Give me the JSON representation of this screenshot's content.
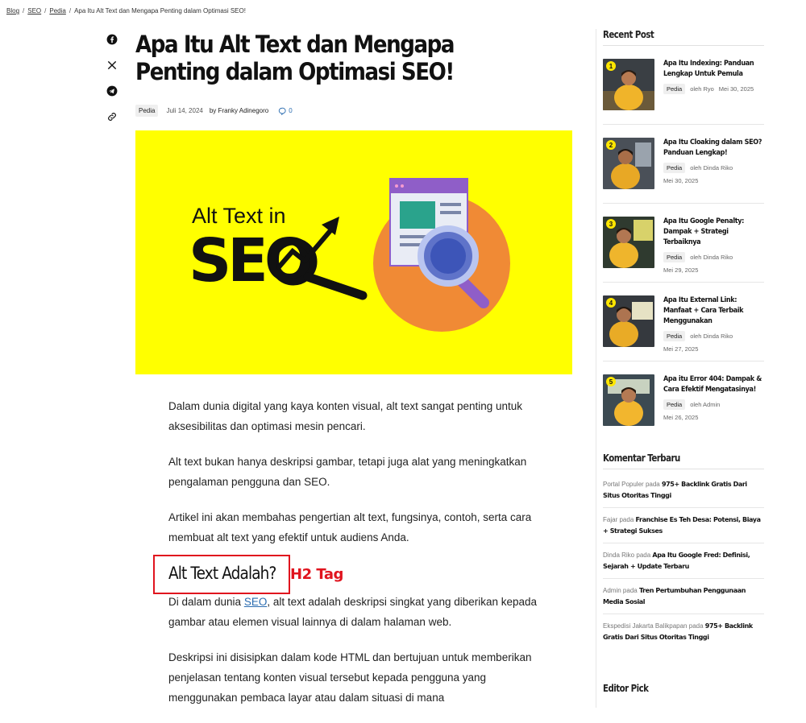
{
  "breadcrumb": {
    "items": [
      "Blog",
      "SEO",
      "Pedia"
    ],
    "current": "Apa Itu Alt Text dan Mengapa Penting dalam Optimasi SEO!"
  },
  "share": [
    "facebook-icon",
    "x-icon",
    "telegram-icon",
    "link-icon"
  ],
  "article": {
    "title": "Apa Itu Alt Text dan Mengapa Penting dalam Optimasi SEO!",
    "category": "Pedia",
    "date": "Juli 14, 2024",
    "author": "by Franky Adinegoro",
    "comment_count": "0",
    "hero": {
      "line1": "Alt Text in",
      "line2": "SEO",
      "bg_color": "#ffff00",
      "circle_color": "#f08a35"
    },
    "paragraphs": [
      "Dalam dunia digital yang kaya konten visual, alt text sangat penting untuk aksesibilitas dan optimasi mesin pencari.",
      "Alt text bukan hanya deskripsi gambar, tetapi juga alat yang meningkatkan pengalaman pengguna dan SEO.",
      "Artikel ini akan membahas pengertian alt text, fungsinya, contoh, serta cara membuat alt text yang efektif untuk audiens Anda."
    ],
    "h2": "Alt Text Adalah?",
    "h2_annotation": "H2 Tag",
    "p4_before": "Di dalam dunia ",
    "p4_link": "SEO",
    "p4_after": ", alt text adalah deskripsi singkat yang diberikan kepada gambar atau elemen visual lainnya di dalam halaman web.",
    "p5": "Deskripsi ini disisipkan dalam kode HTML dan bertujuan untuk memberikan penjelasan tentang konten visual tersebut kepada pengguna yang menggunakan pembaca layar atau dalam situasi di mana"
  },
  "sidebar": {
    "recent_title": "Recent Post",
    "recent_posts": [
      {
        "num": "1",
        "title": "Apa Itu Indexing: Panduan Lengkap Untuk Pemula",
        "category": "Pedia",
        "author": "oleh Ryo",
        "date": "Mei 30, 2025"
      },
      {
        "num": "2",
        "title": "Apa Itu Cloaking dalam SEO? Panduan Lengkap!",
        "category": "Pedia",
        "author": "oleh Dinda Riko",
        "date": "Mei 30, 2025"
      },
      {
        "num": "3",
        "title": "Apa Itu Google Penalty: Dampak + Strategi Terbaiknya",
        "category": "Pedia",
        "author": "oleh Dinda Riko",
        "date": "Mei 29, 2025"
      },
      {
        "num": "4",
        "title": "Apa Itu External Link: Manfaat + Cara Terbaik Menggunakan",
        "category": "Pedia",
        "author": "oleh Dinda Riko",
        "date": "Mei 27, 2025"
      },
      {
        "num": "5",
        "title": "Apa itu Error 404: Dampak & Cara Efektif Mengatasinya!",
        "category": "Pedia",
        "author": "oleh Admin",
        "date": "Mei 26, 2025"
      }
    ],
    "comments_title": "Komentar Terbaru",
    "comments": [
      {
        "author": "Portal Populer",
        "on": "pada",
        "link": "975+ Backlink Gratis Dari Situs Otoritas Tinggi"
      },
      {
        "author": "Fajar",
        "on": "pada",
        "link": "Franchise Es Teh Desa: Potensi, Biaya + Strategi Sukses"
      },
      {
        "author": "Dinda Riko",
        "on": "pada",
        "link": "Apa Itu Google Fred: Definisi, Sejarah + Update Terbaru"
      },
      {
        "author": "Admin",
        "on": "pada",
        "link": "Tren Pertumbuhan Penggunaan Media Sosial"
      },
      {
        "author": "Ekspedisi Jakarta Balikpapan",
        "on": "pada",
        "link": "975+ Backlink Gratis Dari Situs Otoritas Tinggi"
      }
    ],
    "editor_title": "Editor Pick"
  },
  "colors": {
    "accent_link": "#2b6cb0",
    "annotation_red": "#e0141e",
    "thumb_badge": "#ffe600"
  }
}
